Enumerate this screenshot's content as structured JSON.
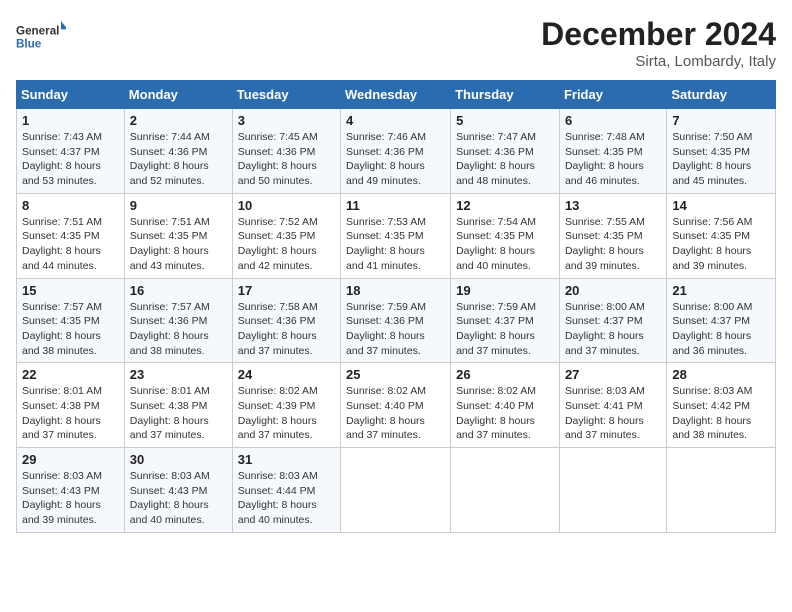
{
  "logo": {
    "line1": "General",
    "line2": "Blue"
  },
  "title": "December 2024",
  "subtitle": "Sirta, Lombardy, Italy",
  "days_header": [
    "Sunday",
    "Monday",
    "Tuesday",
    "Wednesday",
    "Thursday",
    "Friday",
    "Saturday"
  ],
  "weeks": [
    [
      {
        "day": "1",
        "sunrise": "Sunrise: 7:43 AM",
        "sunset": "Sunset: 4:37 PM",
        "daylight": "Daylight: 8 hours and 53 minutes."
      },
      {
        "day": "2",
        "sunrise": "Sunrise: 7:44 AM",
        "sunset": "Sunset: 4:36 PM",
        "daylight": "Daylight: 8 hours and 52 minutes."
      },
      {
        "day": "3",
        "sunrise": "Sunrise: 7:45 AM",
        "sunset": "Sunset: 4:36 PM",
        "daylight": "Daylight: 8 hours and 50 minutes."
      },
      {
        "day": "4",
        "sunrise": "Sunrise: 7:46 AM",
        "sunset": "Sunset: 4:36 PM",
        "daylight": "Daylight: 8 hours and 49 minutes."
      },
      {
        "day": "5",
        "sunrise": "Sunrise: 7:47 AM",
        "sunset": "Sunset: 4:36 PM",
        "daylight": "Daylight: 8 hours and 48 minutes."
      },
      {
        "day": "6",
        "sunrise": "Sunrise: 7:48 AM",
        "sunset": "Sunset: 4:35 PM",
        "daylight": "Daylight: 8 hours and 46 minutes."
      },
      {
        "day": "7",
        "sunrise": "Sunrise: 7:50 AM",
        "sunset": "Sunset: 4:35 PM",
        "daylight": "Daylight: 8 hours and 45 minutes."
      }
    ],
    [
      {
        "day": "8",
        "sunrise": "Sunrise: 7:51 AM",
        "sunset": "Sunset: 4:35 PM",
        "daylight": "Daylight: 8 hours and 44 minutes."
      },
      {
        "day": "9",
        "sunrise": "Sunrise: 7:51 AM",
        "sunset": "Sunset: 4:35 PM",
        "daylight": "Daylight: 8 hours and 43 minutes."
      },
      {
        "day": "10",
        "sunrise": "Sunrise: 7:52 AM",
        "sunset": "Sunset: 4:35 PM",
        "daylight": "Daylight: 8 hours and 42 minutes."
      },
      {
        "day": "11",
        "sunrise": "Sunrise: 7:53 AM",
        "sunset": "Sunset: 4:35 PM",
        "daylight": "Daylight: 8 hours and 41 minutes."
      },
      {
        "day": "12",
        "sunrise": "Sunrise: 7:54 AM",
        "sunset": "Sunset: 4:35 PM",
        "daylight": "Daylight: 8 hours and 40 minutes."
      },
      {
        "day": "13",
        "sunrise": "Sunrise: 7:55 AM",
        "sunset": "Sunset: 4:35 PM",
        "daylight": "Daylight: 8 hours and 39 minutes."
      },
      {
        "day": "14",
        "sunrise": "Sunrise: 7:56 AM",
        "sunset": "Sunset: 4:35 PM",
        "daylight": "Daylight: 8 hours and 39 minutes."
      }
    ],
    [
      {
        "day": "15",
        "sunrise": "Sunrise: 7:57 AM",
        "sunset": "Sunset: 4:35 PM",
        "daylight": "Daylight: 8 hours and 38 minutes."
      },
      {
        "day": "16",
        "sunrise": "Sunrise: 7:57 AM",
        "sunset": "Sunset: 4:36 PM",
        "daylight": "Daylight: 8 hours and 38 minutes."
      },
      {
        "day": "17",
        "sunrise": "Sunrise: 7:58 AM",
        "sunset": "Sunset: 4:36 PM",
        "daylight": "Daylight: 8 hours and 37 minutes."
      },
      {
        "day": "18",
        "sunrise": "Sunrise: 7:59 AM",
        "sunset": "Sunset: 4:36 PM",
        "daylight": "Daylight: 8 hours and 37 minutes."
      },
      {
        "day": "19",
        "sunrise": "Sunrise: 7:59 AM",
        "sunset": "Sunset: 4:37 PM",
        "daylight": "Daylight: 8 hours and 37 minutes."
      },
      {
        "day": "20",
        "sunrise": "Sunrise: 8:00 AM",
        "sunset": "Sunset: 4:37 PM",
        "daylight": "Daylight: 8 hours and 37 minutes."
      },
      {
        "day": "21",
        "sunrise": "Sunrise: 8:00 AM",
        "sunset": "Sunset: 4:37 PM",
        "daylight": "Daylight: 8 hours and 36 minutes."
      }
    ],
    [
      {
        "day": "22",
        "sunrise": "Sunrise: 8:01 AM",
        "sunset": "Sunset: 4:38 PM",
        "daylight": "Daylight: 8 hours and 37 minutes."
      },
      {
        "day": "23",
        "sunrise": "Sunrise: 8:01 AM",
        "sunset": "Sunset: 4:38 PM",
        "daylight": "Daylight: 8 hours and 37 minutes."
      },
      {
        "day": "24",
        "sunrise": "Sunrise: 8:02 AM",
        "sunset": "Sunset: 4:39 PM",
        "daylight": "Daylight: 8 hours and 37 minutes."
      },
      {
        "day": "25",
        "sunrise": "Sunrise: 8:02 AM",
        "sunset": "Sunset: 4:40 PM",
        "daylight": "Daylight: 8 hours and 37 minutes."
      },
      {
        "day": "26",
        "sunrise": "Sunrise: 8:02 AM",
        "sunset": "Sunset: 4:40 PM",
        "daylight": "Daylight: 8 hours and 37 minutes."
      },
      {
        "day": "27",
        "sunrise": "Sunrise: 8:03 AM",
        "sunset": "Sunset: 4:41 PM",
        "daylight": "Daylight: 8 hours and 37 minutes."
      },
      {
        "day": "28",
        "sunrise": "Sunrise: 8:03 AM",
        "sunset": "Sunset: 4:42 PM",
        "daylight": "Daylight: 8 hours and 38 minutes."
      }
    ],
    [
      {
        "day": "29",
        "sunrise": "Sunrise: 8:03 AM",
        "sunset": "Sunset: 4:43 PM",
        "daylight": "Daylight: 8 hours and 39 minutes."
      },
      {
        "day": "30",
        "sunrise": "Sunrise: 8:03 AM",
        "sunset": "Sunset: 4:43 PM",
        "daylight": "Daylight: 8 hours and 40 minutes."
      },
      {
        "day": "31",
        "sunrise": "Sunrise: 8:03 AM",
        "sunset": "Sunset: 4:44 PM",
        "daylight": "Daylight: 8 hours and 40 minutes."
      },
      null,
      null,
      null,
      null
    ]
  ]
}
